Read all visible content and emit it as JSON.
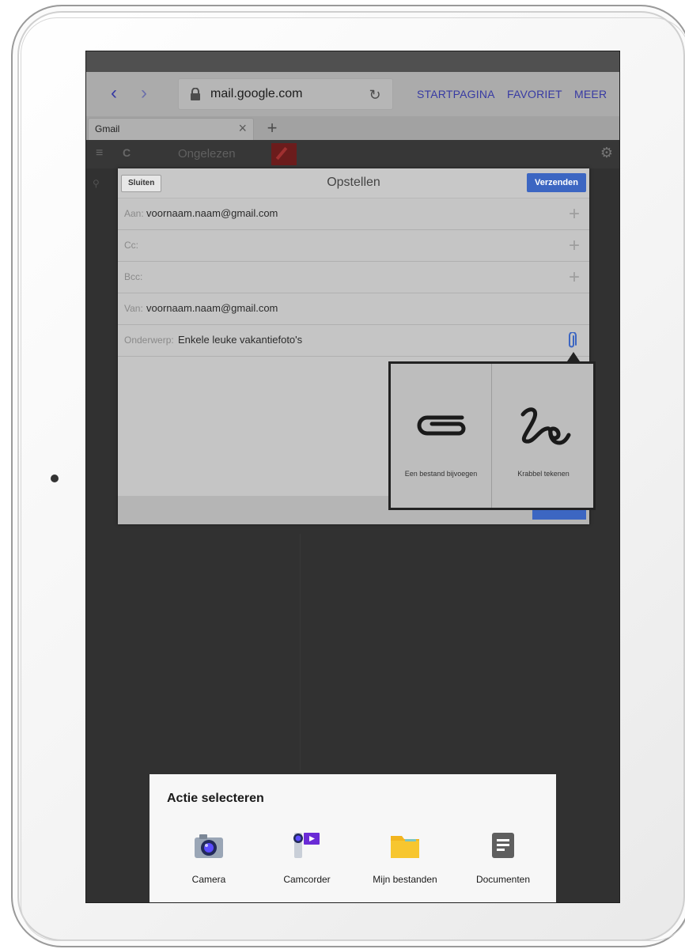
{
  "browser": {
    "url": "mail.google.com",
    "links": [
      "STARTPAGINA",
      "FAVORIET",
      "MEER"
    ],
    "tab_title": "Gmail"
  },
  "gmail": {
    "folder": "Ongelezen"
  },
  "compose": {
    "close_label": "Sluiten",
    "title": "Opstellen",
    "send_label": "Verzenden",
    "to_label": "Aan:",
    "to_value": "voornaam.naam@gmail.com",
    "cc_label": "Cc:",
    "bcc_label": "Bcc:",
    "from_label": "Van:",
    "from_value": "voornaam.naam@gmail.com",
    "subject_label": "Onderwerp:",
    "subject_value": "Enkele leuke vakantiefoto's"
  },
  "attach_menu": {
    "options": [
      {
        "label": "Een bestand bijvoegen",
        "icon": "paperclip-icon"
      },
      {
        "label": "Krabbel tekenen",
        "icon": "scribble-icon"
      }
    ]
  },
  "action_sheet": {
    "title": "Actie selecteren",
    "items": [
      {
        "label": "Camera",
        "icon": "camera-icon"
      },
      {
        "label": "Camcorder",
        "icon": "camcorder-icon"
      },
      {
        "label": "Mijn bestanden",
        "icon": "folder-icon"
      },
      {
        "label": "Documenten",
        "icon": "document-icon"
      }
    ]
  },
  "colors": {
    "accent_blue": "#3c66c2",
    "link_blue": "#3b3fbf",
    "folder_yellow": "#f7c62f"
  }
}
